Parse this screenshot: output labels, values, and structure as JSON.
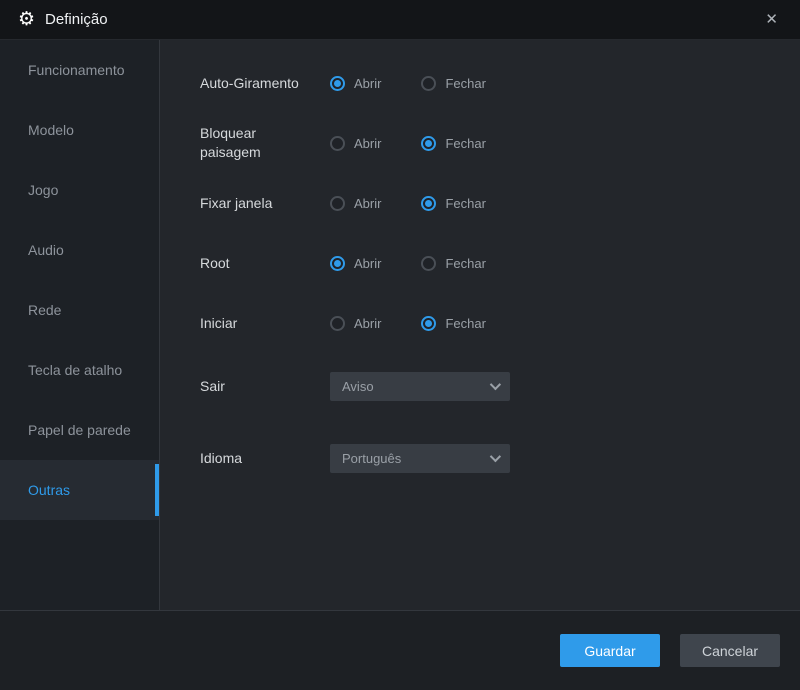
{
  "window": {
    "title": "Definição"
  },
  "icons": {
    "gear": "⚙",
    "close": "✕"
  },
  "colors": {
    "accent": "#2f9bea",
    "titlebar_bg": "#131518",
    "sidebar_bg": "#1d2126",
    "content_bg": "#23262b",
    "button_cancel_bg": "#3f454d"
  },
  "sidebar": {
    "items": [
      {
        "label": "Funcionamento",
        "selected": false
      },
      {
        "label": "Modelo",
        "selected": false
      },
      {
        "label": "Jogo",
        "selected": false
      },
      {
        "label": "Audio",
        "selected": false
      },
      {
        "label": "Rede",
        "selected": false
      },
      {
        "label": "Tecla de atalho",
        "selected": false
      },
      {
        "label": "Papel de parede",
        "selected": false
      },
      {
        "label": "Outras",
        "selected": true
      }
    ]
  },
  "settings": {
    "radio_rows": [
      {
        "label": "Auto-Giramento",
        "options": [
          "Abrir",
          "Fechar"
        ],
        "selected": "Abrir"
      },
      {
        "label": "Bloquear paisagem",
        "options": [
          "Abrir",
          "Fechar"
        ],
        "selected": "Fechar"
      },
      {
        "label": "Fixar janela",
        "options": [
          "Abrir",
          "Fechar"
        ],
        "selected": "Fechar"
      },
      {
        "label": "Root",
        "options": [
          "Abrir",
          "Fechar"
        ],
        "selected": "Abrir"
      },
      {
        "label": "Iniciar",
        "options": [
          "Abrir",
          "Fechar"
        ],
        "selected": "Fechar"
      }
    ],
    "dropdown_rows": [
      {
        "label": "Sair",
        "value": "Aviso"
      },
      {
        "label": "Idioma",
        "value": "Português"
      }
    ]
  },
  "footer": {
    "save_label": "Guardar",
    "cancel_label": "Cancelar"
  }
}
